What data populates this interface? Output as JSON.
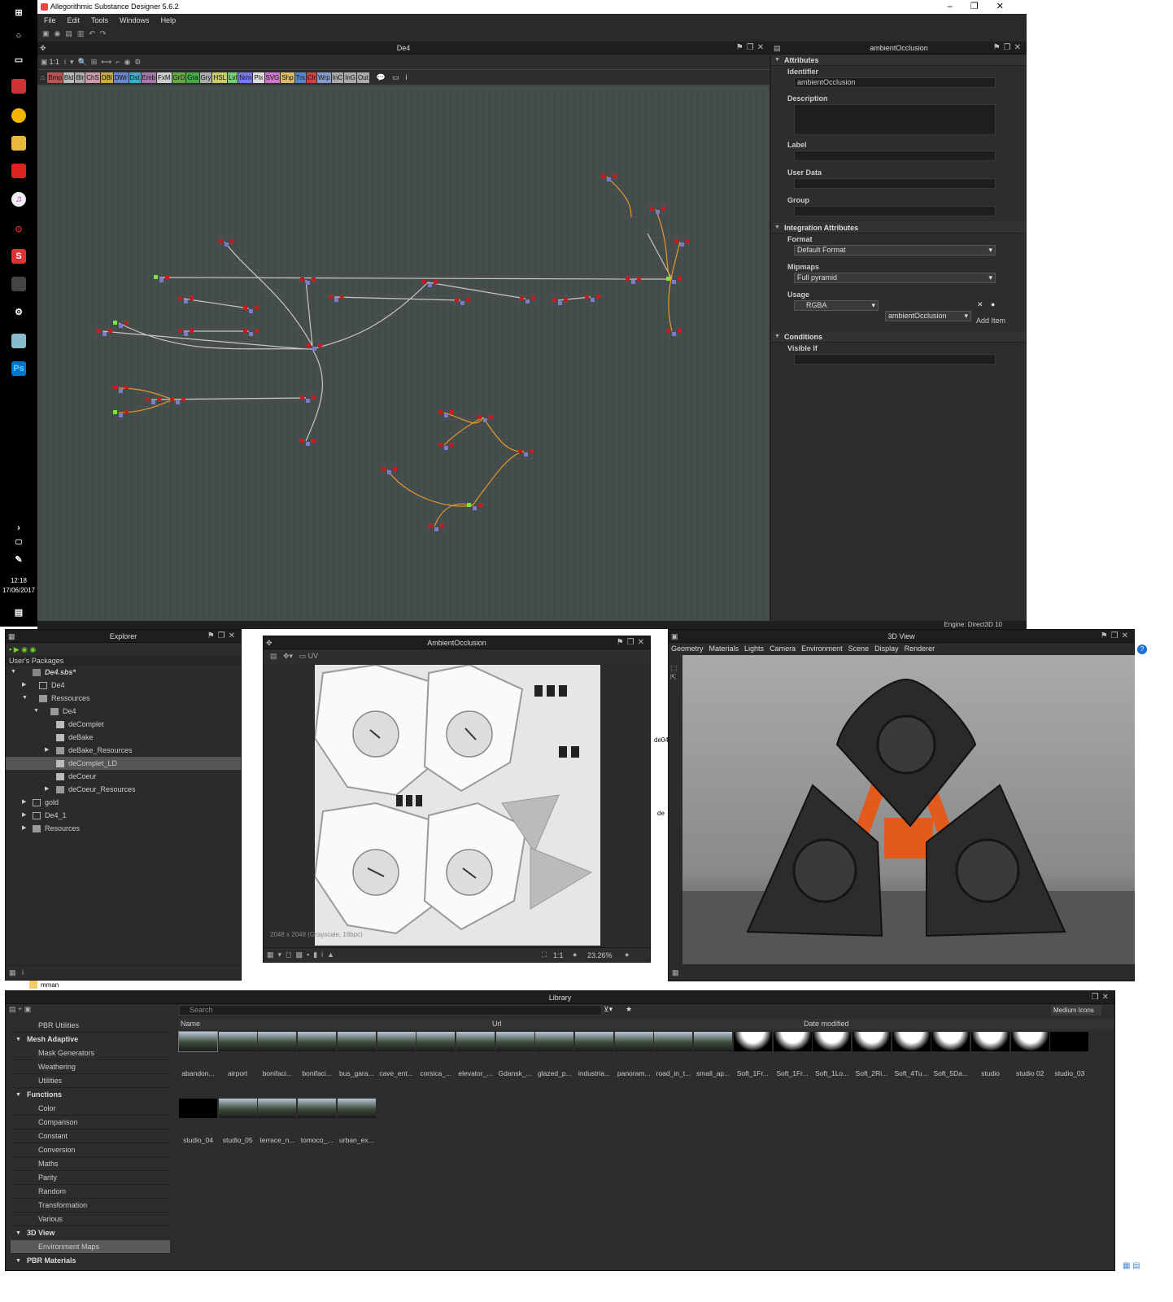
{
  "app": {
    "title": "Allegorithmic Substance Designer 5.6.2",
    "menu": [
      "File",
      "Edit",
      "Tools",
      "Windows",
      "Help"
    ]
  },
  "taskbar": {
    "time": "12:18",
    "date": "17/06/2017",
    "notif": "2"
  },
  "graph": {
    "tab": "De4",
    "zoom": "1:1",
    "nodes": [
      "Bmp",
      "Bld",
      "Blr",
      "ChS",
      "DBl",
      "DWr",
      "Dst",
      "Emb",
      "FxM",
      "GrD",
      "Gra",
      "Gry",
      "HSL",
      "Lvl",
      "Nrm",
      "Plx",
      "SVG",
      "Shp",
      "Trs",
      "Clr",
      "Wrp",
      "InC",
      "InG",
      "Out"
    ]
  },
  "props": {
    "tab": "ambientOcclusion",
    "sections": {
      "attributes": "Attributes",
      "integration": "Integration Attributes",
      "conditions": "Conditions"
    },
    "identifier_label": "Identifier",
    "identifier": "ambientOcclusion",
    "description_label": "Description",
    "label_label": "Label",
    "userdata_label": "User Data",
    "group_label": "Group",
    "format_label": "Format",
    "format": "Default Format",
    "mipmaps_label": "Mipmaps",
    "mipmaps": "Full pyramid",
    "usage_label": "Usage",
    "usage_channel": "RGBA",
    "usage_value": "ambientOcclusion",
    "add_item": "Add Item",
    "visibleif_label": "Visible If"
  },
  "status": "Engine: Direct3D 10",
  "explorer": {
    "title": "Explorer",
    "root": "User's Packages",
    "items": [
      "De4.sbs*",
      "De4",
      "Ressources",
      "De4",
      "deComplet",
      "deBake",
      "deBake_Resources",
      "deComplet_LD",
      "deCoeur",
      "deCoeur_Resources",
      "gold",
      "De4_1",
      "Resources"
    ]
  },
  "ao": {
    "title": "AmbientOcclusion",
    "info": "2048 x 2048 (Grayscale, 16bpc)",
    "ratio": "1:1",
    "zoom": "23.26%",
    "uv": "UV"
  },
  "v3d": {
    "title": "3D View",
    "menu": [
      "Geometry",
      "Materials",
      "Lights",
      "Camera",
      "Environment",
      "Scene",
      "Display",
      "Renderer"
    ]
  },
  "behind": {
    "folder": "mman",
    "file1": "de04",
    "file2": "de"
  },
  "library": {
    "title": "Library",
    "search_placeholder": "Search",
    "view": "Medium Icons",
    "cols": [
      "Name",
      "Url",
      "Date modified"
    ],
    "tree": [
      {
        "t": "r",
        "l": "PBR Utilities"
      },
      {
        "t": "h",
        "l": "Mesh Adaptive"
      },
      {
        "t": "r",
        "l": "Mask Generators"
      },
      {
        "t": "r",
        "l": "Weathering"
      },
      {
        "t": "r",
        "l": "Utilities"
      },
      {
        "t": "h",
        "l": "Functions"
      },
      {
        "t": "r",
        "l": "Color"
      },
      {
        "t": "r",
        "l": "Comparison"
      },
      {
        "t": "r",
        "l": "Constant"
      },
      {
        "t": "r",
        "l": "Conversion"
      },
      {
        "t": "r",
        "l": "Maths"
      },
      {
        "t": "r",
        "l": "Parity"
      },
      {
        "t": "r",
        "l": "Random"
      },
      {
        "t": "r",
        "l": "Transformation"
      },
      {
        "t": "r",
        "l": "Various"
      },
      {
        "t": "h",
        "l": "3D View"
      },
      {
        "t": "s",
        "l": "Environment Maps"
      },
      {
        "t": "h",
        "l": "PBR Materials"
      }
    ],
    "items": [
      "abandon...",
      "airport",
      "bonifaci...",
      "bonifaci...",
      "bus_gara...",
      "cave_ent...",
      "corsica_...",
      "elevator_...",
      "Gdansk_...",
      "glazed_p...",
      "industria...",
      "panoram...",
      "road_in_t...",
      "small_ap...",
      "Soft_1Fr...",
      "Soft_1Fr...",
      "Soft_1Lo...",
      "Soft_2Ri...",
      "Soft_4Tu...",
      "Soft_5Da...",
      "studio",
      "studio 02",
      "studio_03",
      "studio_04",
      "studio_05",
      "terrace_n...",
      "tomoco_...",
      "urban_ex..."
    ]
  }
}
